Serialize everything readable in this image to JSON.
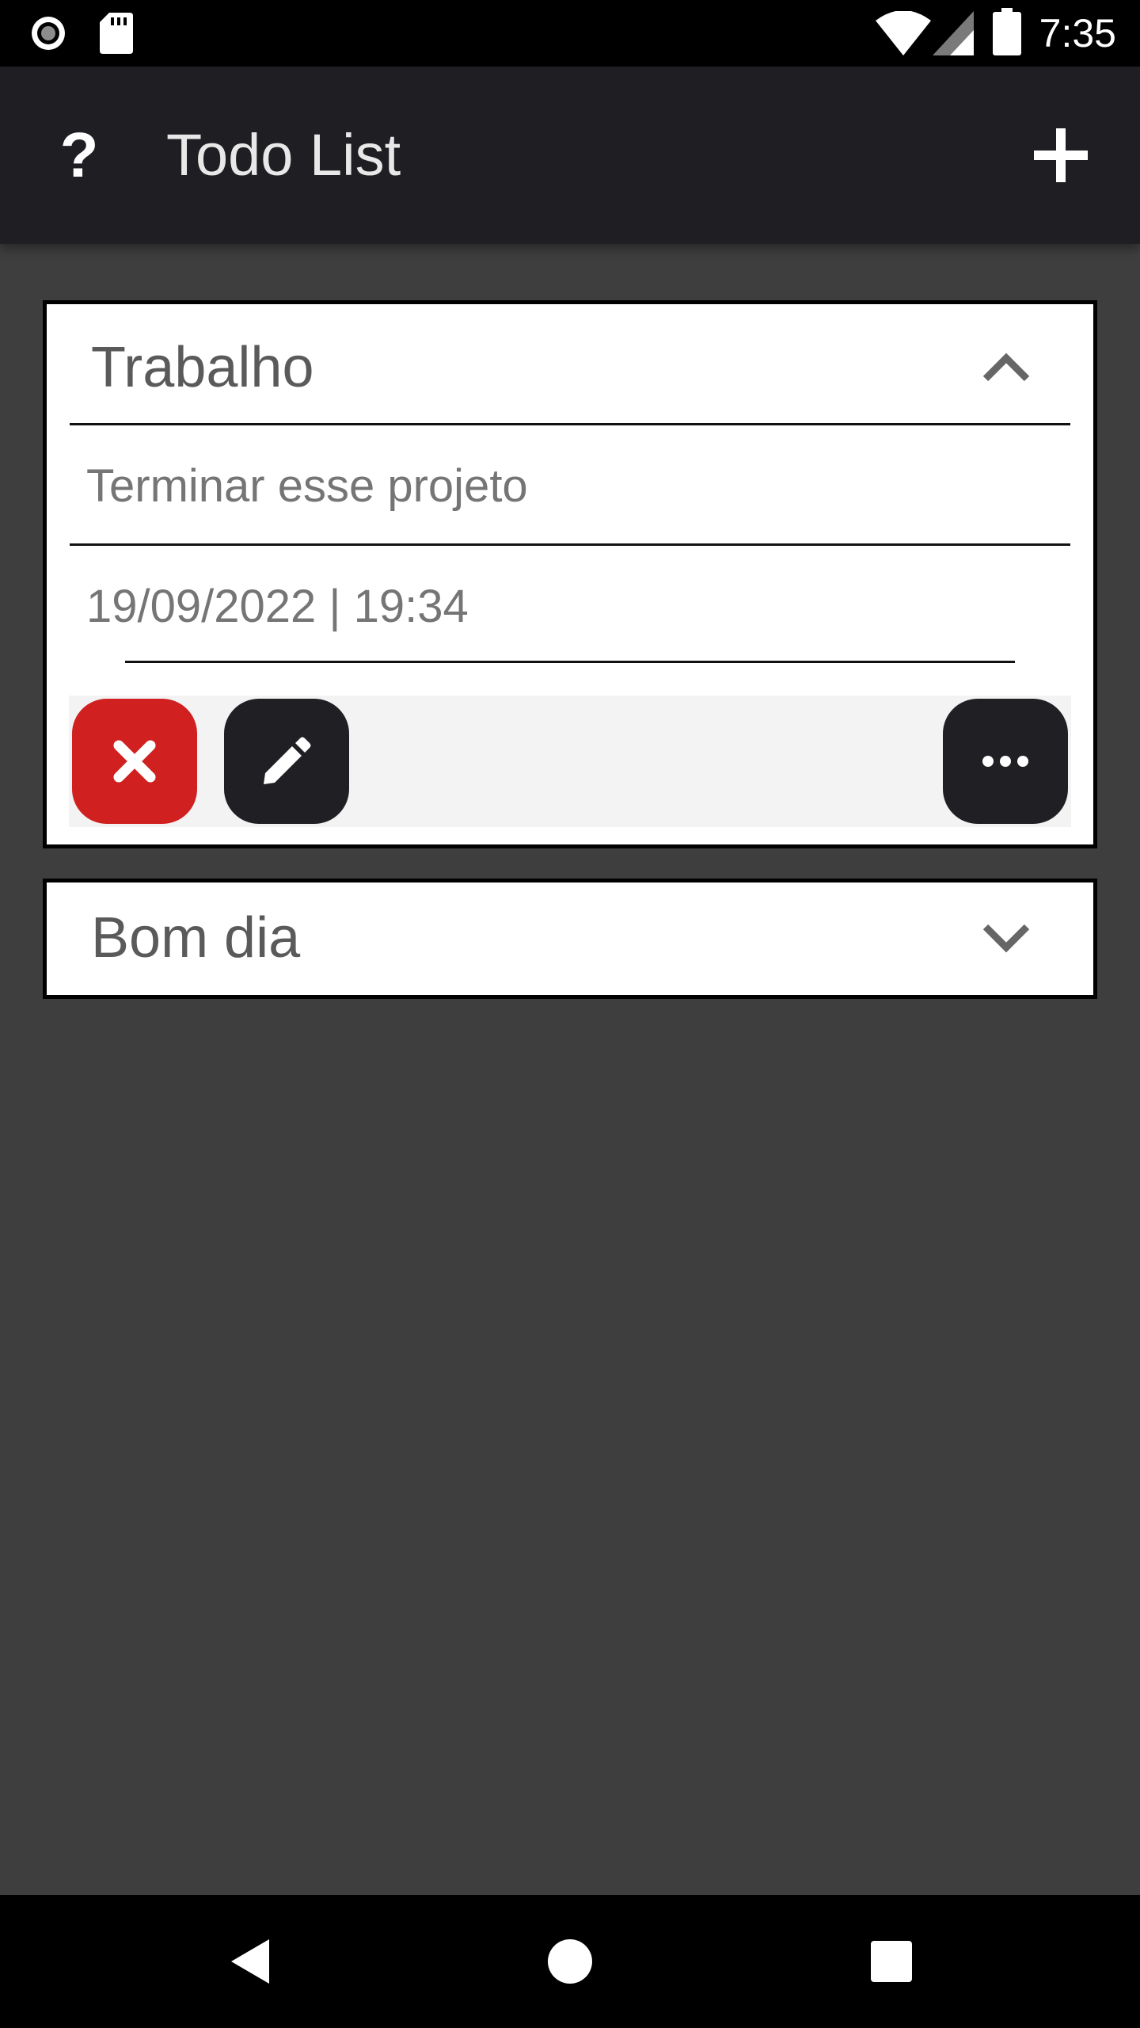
{
  "status_bar": {
    "time": "7:35",
    "icons": [
      "record-icon",
      "sd-card-icon",
      "wifi-icon",
      "signal-icon",
      "battery-icon"
    ]
  },
  "app_bar": {
    "title": "Todo List",
    "help_label": "?",
    "add_icon": "plus-icon"
  },
  "todos": [
    {
      "title": "Trabalho",
      "expanded": true,
      "description": "Terminar esse projeto",
      "datetime": "19/09/2022 | 19:34",
      "actions": [
        "delete",
        "edit",
        "more"
      ]
    },
    {
      "title": "Bom dia",
      "expanded": false
    }
  ],
  "nav_bar": {
    "buttons": [
      "back",
      "home",
      "recents"
    ]
  },
  "colors": {
    "background": "#3e3e3e",
    "app_bar": "#1f1f23",
    "delete": "#d02020",
    "dark_button": "#1f1f24",
    "card": "#ffffff"
  }
}
